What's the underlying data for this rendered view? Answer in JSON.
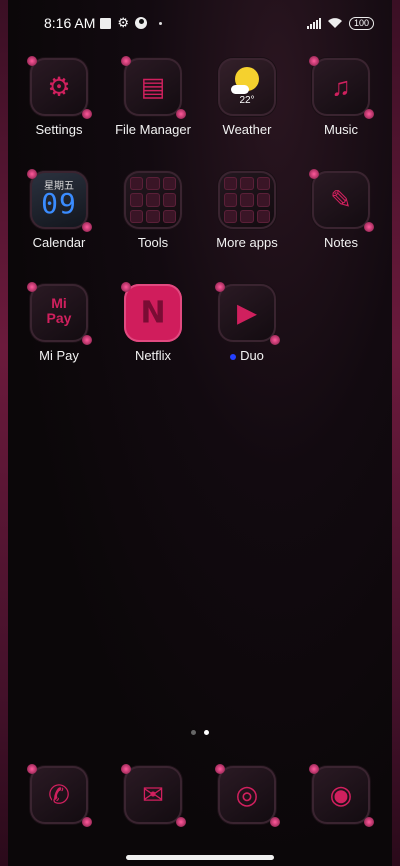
{
  "status_bar": {
    "time": "8:16 AM",
    "battery": "100",
    "icons": [
      "notification-square-icon",
      "settings-gear-icon",
      "camera-icon",
      "signal-icon",
      "wifi-icon",
      "battery-icon"
    ]
  },
  "apps": [
    {
      "name": "Settings",
      "glyph": "⚙"
    },
    {
      "name": "File Manager",
      "glyph": "▤"
    },
    {
      "name": "Weather",
      "temp": "22°"
    },
    {
      "name": "Music",
      "glyph": "♫"
    },
    {
      "name": "Calendar",
      "weekday": "星期五",
      "day": "09"
    },
    {
      "name": "Tools"
    },
    {
      "name": "More apps"
    },
    {
      "name": "Notes",
      "glyph": "✎"
    },
    {
      "name": "Mi Pay",
      "line1": "Mi",
      "line2": "Pay"
    },
    {
      "name": "Netflix",
      "glyph": "N"
    },
    {
      "name": "Duo",
      "glyph": "▶"
    }
  ],
  "dock": [
    {
      "name": "Phone",
      "glyph": "✆"
    },
    {
      "name": "Messages",
      "glyph": "✉"
    },
    {
      "name": "Browser",
      "glyph": "◎"
    },
    {
      "name": "Camera",
      "glyph": "◉"
    }
  ],
  "pager": {
    "pages": 2,
    "active": 2
  }
}
